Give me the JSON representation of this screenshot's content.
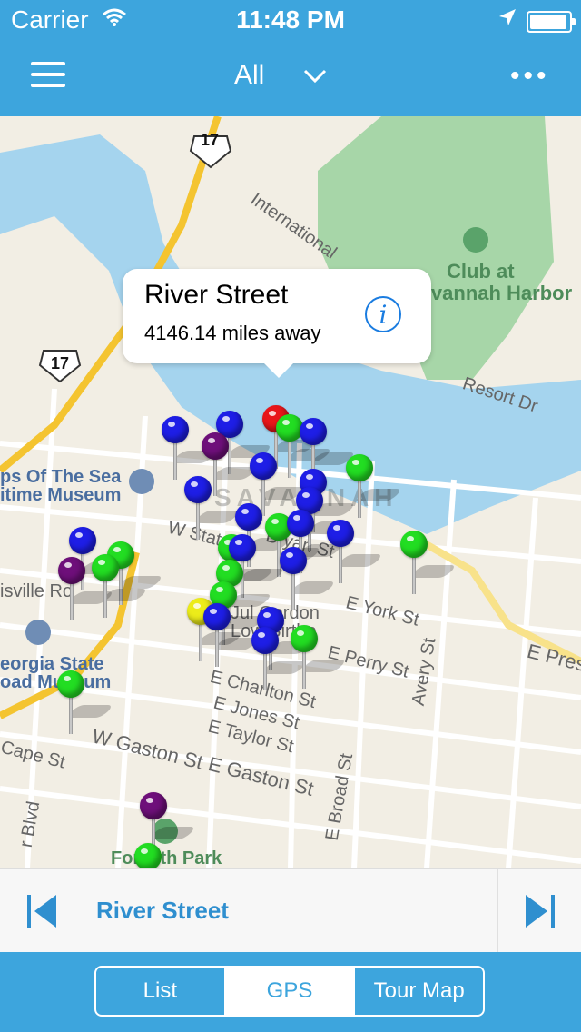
{
  "status_bar": {
    "carrier": "Carrier",
    "time": "11:48 PM",
    "wifi_icon": "wifi-icon",
    "location_icon": "location-arrow-icon",
    "battery_icon": "battery-icon"
  },
  "nav": {
    "filter_label": "All",
    "menu_icon": "hamburger-menu-icon",
    "filter_icon": "chevron-down-icon",
    "more_icon": "more-dots-icon",
    "more_label": "•••"
  },
  "map": {
    "labels": {
      "highway_17_top": "17",
      "highway_17_left": "17",
      "international": "International",
      "club": "Club at",
      "club2": "Savannah Harbor",
      "resort": "Resort Dr",
      "ships": "ps Of The Sea",
      "ships2": "itime Museum",
      "savannah": "SAVANNAH",
      "louisville": "isville Ro",
      "georgia": "eorgia State",
      "georgia2": "oad Museum",
      "eyork": "E York St",
      "eperry": "E Perry St",
      "echarlton": "E Charlton St",
      "ejones": "E Jones St",
      "etaylor": "E Taylor St",
      "wgaston": "W Gaston St",
      "egaston": "E Gaston St",
      "ebroad": "E Broad St",
      "avery": "Avery St",
      "epresi": "E Presi",
      "cape": "Cape St",
      "lowbirth": "Low Birthp",
      "juliette": "Jul     Gordon",
      "wstate": "W State",
      "bryan": "Bryan St",
      "blvd": "r Blvd",
      "park": "Forsyth Park"
    },
    "pin_colors": {
      "blue": "#1e1ee6",
      "green": "#22dd22",
      "red": "#e8161a",
      "purple": "#6e0f7a",
      "yellow": "#ecec1a"
    }
  },
  "callout": {
    "title": "River Street",
    "subtitle": "4146.14 miles away",
    "info_label": "i",
    "info_icon": "info-icon"
  },
  "stop_bar": {
    "current_stop": "River Street",
    "prev_icon": "skip-previous-icon",
    "next_icon": "skip-next-icon"
  },
  "tabs": {
    "list": "List",
    "gps": "GPS",
    "tour_map": "Tour Map",
    "active": "GPS"
  }
}
